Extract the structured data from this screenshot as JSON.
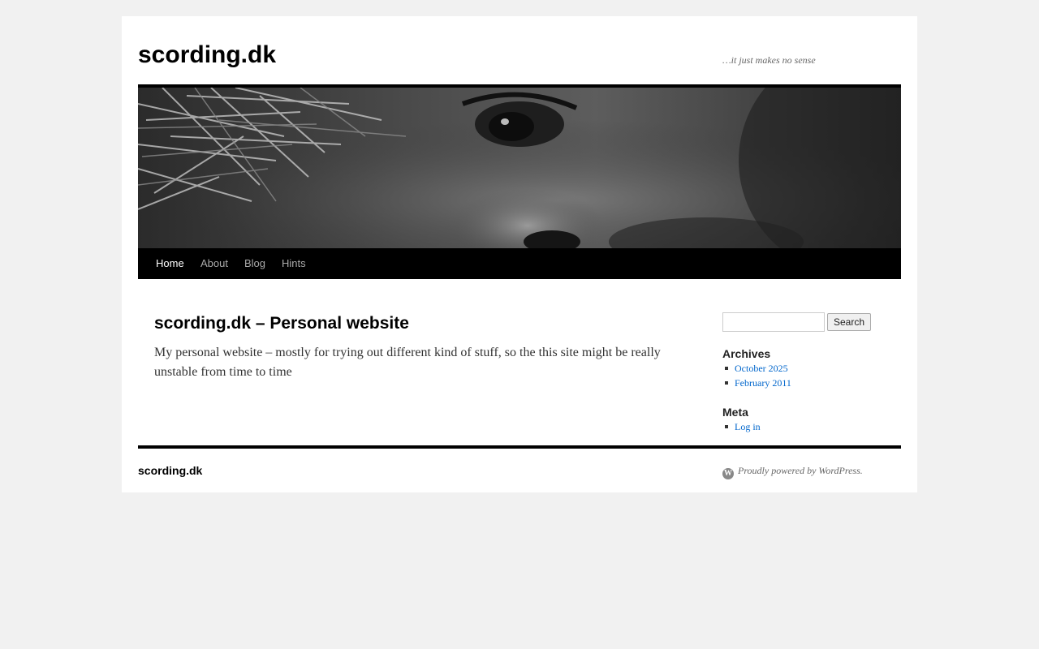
{
  "site": {
    "title": "scording.dk",
    "description": "…it just makes no sense"
  },
  "header_image": {
    "description": "black-and-white close-up photo of a face with spiky hair"
  },
  "nav": {
    "items": [
      {
        "label": "Home",
        "current": true
      },
      {
        "label": "About"
      },
      {
        "label": "Blog"
      },
      {
        "label": "Hints"
      }
    ]
  },
  "entry": {
    "title": "scording.dk – Personal website",
    "content": "My personal website – mostly for trying out different kind of stuff, so the this site might be really unstable from time to time"
  },
  "sidebar": {
    "search": {
      "placeholder": "",
      "button_label": "Search"
    },
    "archives": {
      "title": "Archives",
      "items": [
        "October 2025",
        "February 2011"
      ]
    },
    "meta": {
      "title": "Meta",
      "items": [
        "Log in"
      ]
    }
  },
  "footer": {
    "site_title": "scording.dk",
    "credit": "Proudly powered by WordPress.",
    "credit_icon": "wordpress-icon"
  },
  "colors": {
    "page_bg": "#f1f1f1",
    "nav_bg": "#000000",
    "link": "#0066cc"
  }
}
